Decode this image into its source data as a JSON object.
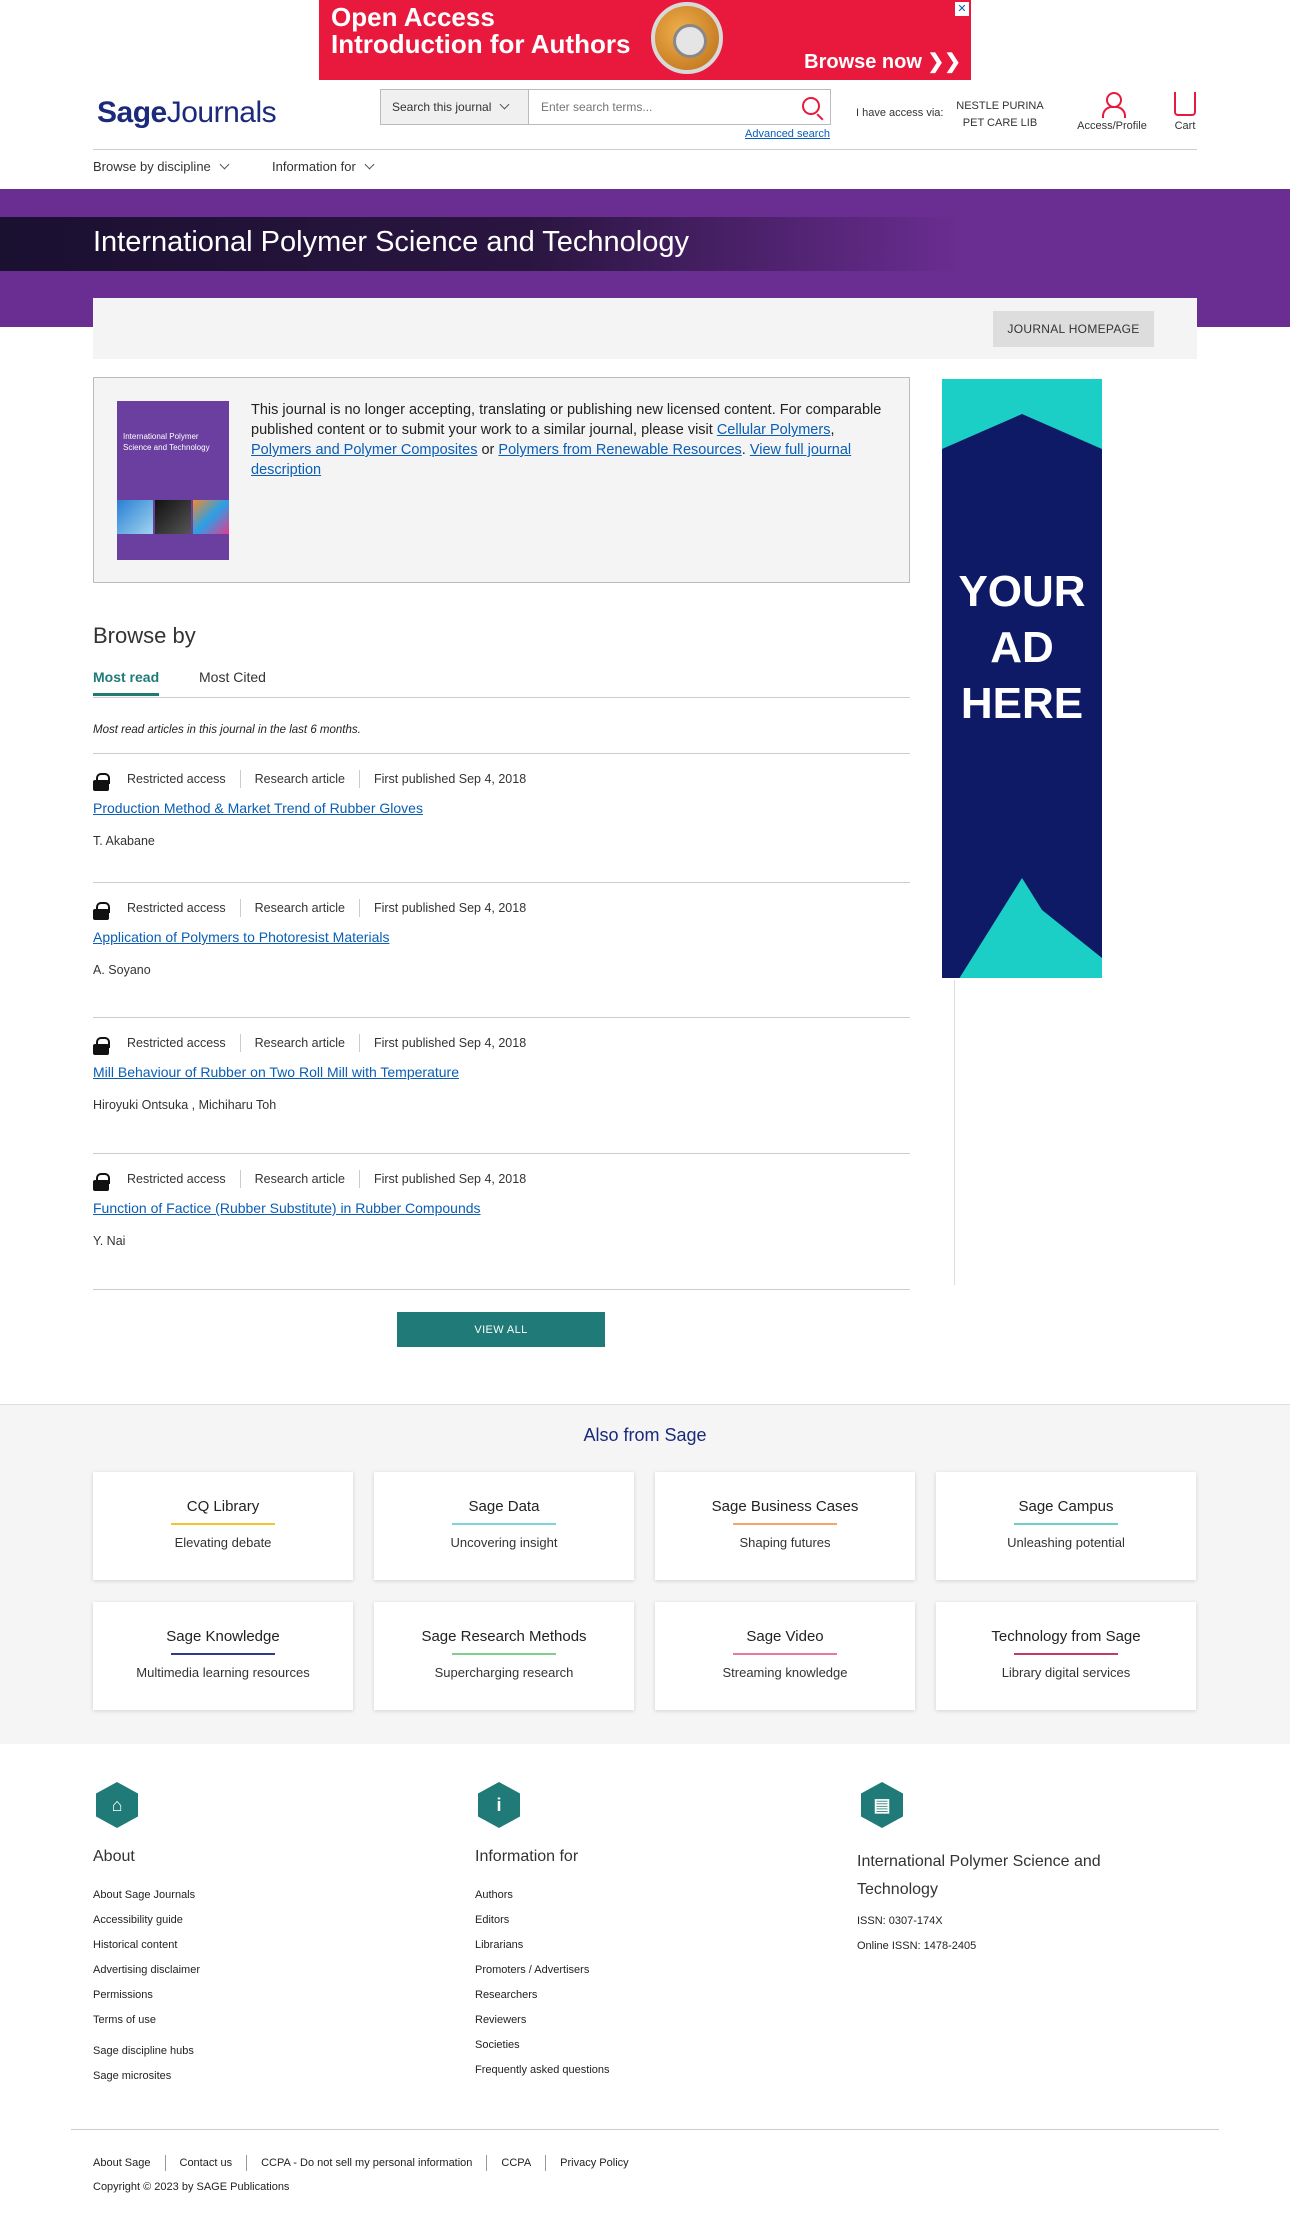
{
  "ad_banner": {
    "line1": "Open Access",
    "line2": "Introduction for Authors",
    "cta": "Browse now ❯❯"
  },
  "header": {
    "logo_a": "Sage",
    "logo_b": "Journals",
    "search_scope": "Search this journal",
    "search_placeholder": "Enter search terms...",
    "advanced_search": "Advanced search",
    "access_label": "I have access via:",
    "access_name": "NESTLE PURINA PET CARE LIB",
    "profile_label": "Access/Profile",
    "cart_label": "Cart"
  },
  "nav": {
    "browse": "Browse by discipline",
    "info": "Information for"
  },
  "journal": {
    "title": "International Polymer Science and Technology",
    "homepage_button": "JOURNAL HOMEPAGE",
    "cover_title": "International Polymer Science and Technology"
  },
  "notice": {
    "text_before": "This journal is no longer accepting, translating or publishing new licensed content. For comparable published content or to submit your work to a similar journal, please visit ",
    "link1": "Cellular Polymers",
    "sep1": ", ",
    "link2": "Polymers and Polymer Composites",
    "sep2": " or ",
    "link3": "Polymers from Renewable Resources",
    "sep3": ". ",
    "link4": "View full journal description"
  },
  "side_ad": {
    "line1": "YOUR",
    "line2": "AD",
    "line3": "HERE"
  },
  "browse": {
    "heading": "Browse by",
    "tabs": [
      "Most read",
      "Most Cited"
    ],
    "note": "Most read articles in this journal in the last 6 months.",
    "articles": [
      {
        "access": "Restricted access",
        "type": "Research article",
        "published": "First published  Sep 4, 2018",
        "title": "Production Method & Market Trend of Rubber Gloves",
        "authors": "T. Akabane"
      },
      {
        "access": "Restricted access",
        "type": "Research article",
        "published": "First published  Sep 4, 2018",
        "title": "Application of Polymers to Photoresist Materials",
        "authors": "A. Soyano"
      },
      {
        "access": "Restricted access",
        "type": "Research article",
        "published": "First published  Sep 4, 2018",
        "title": "Mill Behaviour of Rubber on Two Roll Mill with Temperature",
        "authors": "Hiroyuki Ontsuka , Michiharu Toh"
      },
      {
        "access": "Restricted access",
        "type": "Research article",
        "published": "First published  Sep 4, 2018",
        "title": "Function of Factice (Rubber Substitute) in Rubber Compounds",
        "authors": "Y. Nai"
      }
    ],
    "view_all": "VIEW ALL"
  },
  "also": {
    "heading": "Also from Sage",
    "cards": [
      {
        "title": "CQ Library",
        "sub": "Elevating debate",
        "color": "#f2c230"
      },
      {
        "title": "Sage Data",
        "sub": "Uncovering insight",
        "color": "#7fd4dc"
      },
      {
        "title": "Sage Business Cases",
        "sub": "Shaping futures",
        "color": "#f2a66a"
      },
      {
        "title": "Sage Campus",
        "sub": "Unleashing potential",
        "color": "#6fcfc6"
      },
      {
        "title": "Sage Knowledge",
        "sub": "Multimedia learning resources",
        "color": "#2d3b8c"
      },
      {
        "title": "Sage Research Methods",
        "sub": "Supercharging research",
        "color": "#7fcf8a"
      },
      {
        "title": "Sage Video",
        "sub": "Streaming knowledge",
        "color": "#e87a9a"
      },
      {
        "title": "Technology from Sage",
        "sub": "Library digital services",
        "color": "#c23a6a"
      }
    ]
  },
  "footer": {
    "about_heading": "About",
    "about_links": [
      "About Sage Journals",
      "Accessibility guide",
      "Historical content",
      "Advertising disclaimer",
      "Permissions",
      "Terms of use"
    ],
    "about_links2": [
      "Sage discipline hubs",
      "Sage microsites"
    ],
    "info_heading": "Information for",
    "info_links": [
      "Authors",
      "Editors",
      "Librarians",
      "Promoters / Advertisers",
      "Researchers",
      "Reviewers",
      "Societies",
      "Frequently asked questions"
    ],
    "journal_heading": "International Polymer Science and Technology",
    "issn": "ISSN: 0307-174X",
    "online_issn": "Online ISSN: 1478-2405",
    "bottom_links": [
      "About Sage",
      "Contact us",
      "CCPA - Do not sell my personal information",
      "CCPA",
      "Privacy Policy"
    ],
    "copyright": "Copyright © 2023 by SAGE Publications"
  }
}
